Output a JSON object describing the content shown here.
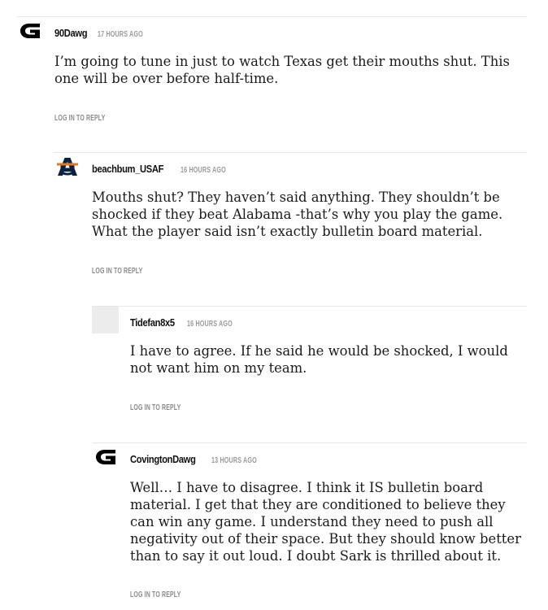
{
  "comments": [
    {
      "username": "90Dawg",
      "timestamp": "17 hours ago",
      "avatar_icon": "georgia-g-logo-icon",
      "body": "I’m going to tune in just to watch Texas get their mouths shut. This one will be over before half-time.",
      "reply_label": "Log in to Reply"
    },
    {
      "username": "beachbum_USAF",
      "timestamp": "16 hours ago",
      "avatar_icon": "auburn-au-logo-icon",
      "body": "Mouths shut? They haven’t said anything. They shouldn’t be shocked if they beat Alabama -that’s why you play the game. What the player said isn’t exactly bulletin board material.",
      "reply_label": "Log in to Reply"
    },
    {
      "username": "Tidefan8x5",
      "timestamp": "16 hours ago",
      "avatar_icon": "blank-avatar-icon",
      "body": "I have to agree. If he said he would be shocked, I would not want him on my team.",
      "reply_label": "Log in to Reply"
    },
    {
      "username": "CovingtonDawg",
      "timestamp": "13 hours ago",
      "avatar_icon": "georgia-g-logo-icon",
      "body": "Well… I have to disagree. I think it IS bulletin board material. I get that they are conditioned to believe they can win any game. I understand they need to push all negativity out of their space. But they should know better than to say it out loud. I doubt Sark is thrilled about it.",
      "reply_label": "Log in to Reply"
    }
  ],
  "colors": {
    "georgia": "#000000",
    "auburn_navy": "#0c2340",
    "auburn_orange": "#e87722",
    "divider": "#e7e7e7",
    "meta_gray": "#9a9a9a"
  }
}
